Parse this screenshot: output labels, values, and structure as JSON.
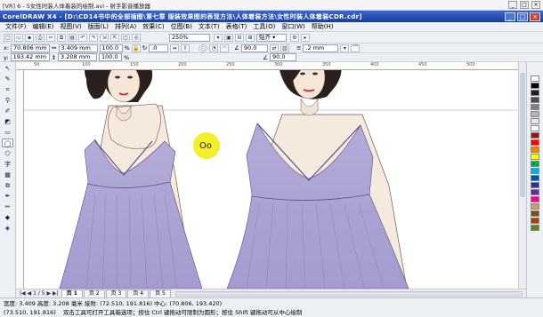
{
  "player": {
    "title": "[VR] 6 - 5女性时装人体着装的绘制.avi - 射手影音播放器",
    "min": "_",
    "max": "□",
    "close": "×"
  },
  "window": {
    "title": "CorelDRAW X4 - [D:\\CD14书中的全部插图\\第七章 服装效果图的表现方法\\人体着装方法\\女性时装人体着装CDR.cdr]",
    "min": "_",
    "restore": "□",
    "close": "×"
  },
  "menu": [
    "文件(F)",
    "编辑(E)",
    "视图(V)",
    "版面(L)",
    "排列(A)",
    "效果(C)",
    "位图(B)",
    "文本(T)",
    "表格(T)",
    "工具(O)",
    "窗口(W)",
    "帮助(H)"
  ],
  "toolbar": {
    "zoom": "250%",
    "snap": "贴齐 ▾",
    "icons": [
      "new-icon",
      "open-icon",
      "save-icon",
      "print-icon",
      "cut-icon",
      "copy-icon",
      "paste-icon",
      "undo-icon",
      "redo-icon",
      "import-icon",
      "export-icon",
      "launcher-icon",
      "welcome-icon"
    ]
  },
  "props": {
    "x": "70.806 mm",
    "y": "193.42 mm",
    "w": "3.409 mm",
    "h": "3.208 mm",
    "scale1": "100.0",
    "scale2": "100.0",
    "angle1": "90.0",
    "angle2": "90.0",
    "outline": ".2 mm",
    "x_label": "x:",
    "y_label": "y:"
  },
  "tools": [
    "pick-tool",
    "shape-tool",
    "crop-tool",
    "zoom-tool",
    "freehand-tool",
    "smart-fill-tool",
    "rectangle-tool",
    "ellipse-tool",
    "polygon-tool",
    "text-tool",
    "table-tool",
    "blend-tool",
    "eyedropper-tool",
    "outline-tool",
    "fill-tool",
    "interactive-fill-tool"
  ],
  "tool_glyphs": [
    "↖",
    "✎",
    "⌗",
    "⚲",
    "✐",
    "◩",
    "▭",
    "◯",
    "⬠",
    "字",
    "▦",
    "⧉",
    "✒",
    "✏",
    "◆",
    "◈"
  ],
  "active_tool": 7,
  "palette": [
    "#ffffff",
    "#000000",
    "#1e1e1e",
    "#4d4d4d",
    "#808080",
    "#b3b3b3",
    "#e6e6e6",
    "#ffffff",
    "#8b1a1a",
    "#ff0000",
    "#ff7f00",
    "#ffff00",
    "#00a651",
    "#00aeef",
    "#0054a6",
    "#2e3192",
    "#662d91",
    "#ec008c",
    "#c69c6d",
    "#754c24",
    "#a0410d",
    "#598527"
  ],
  "ruler_marks": [
    "50",
    "100",
    "150",
    "200",
    "250",
    "300",
    "350",
    "400",
    "450",
    "500"
  ],
  "pages": {
    "nav": "|◀ ◀ 1 / 5 ▶ ▶|",
    "tabs": [
      "页 1",
      "页 2",
      "页 3",
      "页 4",
      "页 5"
    ],
    "active": 0
  },
  "status": {
    "line1": "宽度: 3.409  高度: 3.208 毫米          接附: (72.510, 191.816)   中心: (70.806, 193.420)",
    "coords": "(73.510, 191.816)",
    "hint": "双击工具可打开工具箱选项；按住 Ctrl 键拖动可限制为圆形；按住 Shift 键拖动可从中心绘制"
  },
  "cursor_label": "Oo"
}
